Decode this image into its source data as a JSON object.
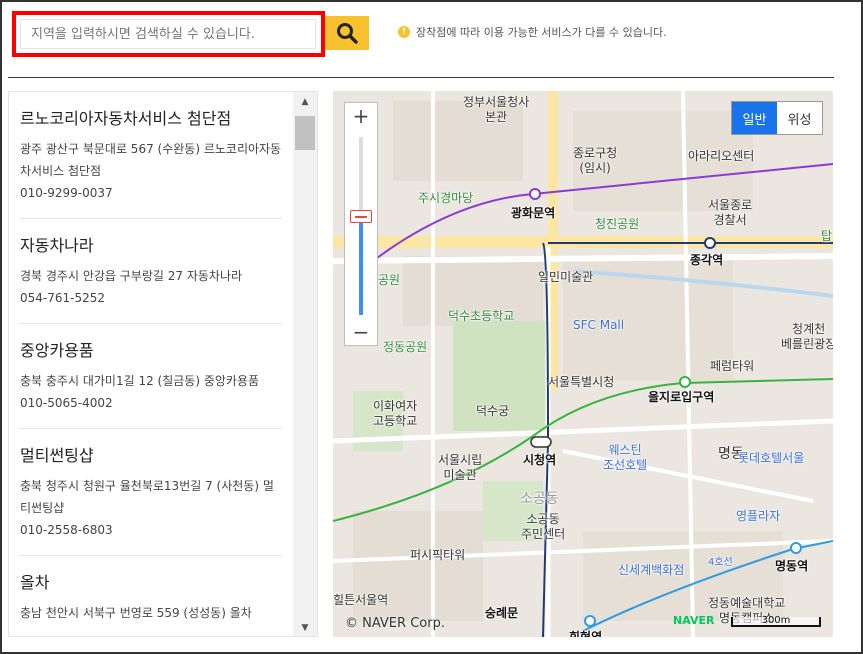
{
  "search": {
    "placeholder": "지역을 입력하시면 검색하실 수 있습니다."
  },
  "notice": {
    "text": "장착점에 따라 이용 가능한 서비스가 다를 수 있습니다."
  },
  "shops": [
    {
      "name": "르노코리아자동차서비스 첨단점",
      "address": "광주 광산구 북문대로 567 (수완동) 르노코리아자동차서비스 첨단점",
      "phone": "010-9299-0037"
    },
    {
      "name": "자동차나라",
      "address": "경북 경주시 안강읍 구부랑길 27 자동차나라",
      "phone": "054-761-5252"
    },
    {
      "name": "중앙카용품",
      "address": "충북 충주시 대가미1길 12 (칠금동) 중앙카용품",
      "phone": "010-5065-4002"
    },
    {
      "name": "멀티썬팅샵",
      "address": "충북 청주시 청원구 율천북로13번길 7 (사천동) 멀티썬팅샵",
      "phone": "010-2558-6803"
    },
    {
      "name": "올차",
      "address": "충남 천안시 서북구 번영로 559 (성성동) 올차",
      "phone": ""
    }
  ],
  "map": {
    "type_buttons": {
      "normal": "일반",
      "satellite": "위성"
    },
    "copyright": "© NAVER Corp.",
    "logo": "NAVER",
    "scale": "300m",
    "labels": {
      "gov": "정부서울청사\n본관",
      "jongno_office": "종로구청\n(임시)",
      "arario": "아라리오센터",
      "jusigyeong": "주시경마당",
      "gwanghwamun": "광화문역",
      "cheongjin": "청진공원",
      "seoul_jongno_police": "서울종로\n경찰서",
      "jonggak": "종각역",
      "ilmin": "일민미술관",
      "park": "공원",
      "deoksu_school": "덕수초등학교",
      "sfc": "SFC Mall",
      "cheonggye": "청계천\n베를린광장",
      "jeongdong": "정동공원",
      "plaza_tower": "페럼타워",
      "seoul_plaza": "서울특별시청",
      "euljiro1": "을지로입구역",
      "ewha": "이화여자\n고등학교",
      "deoksugung": "덕수궁",
      "seoul_museum": "서울시립\n미술관",
      "city_hall": "시청역",
      "westin": "웨스틴\n조선호텔",
      "myeongdong": "명동",
      "lotte": "롯데호텔서울",
      "sogong": "소공동\n주민센터",
      "sogong_big": "소공동",
      "young_plaza": "영플라자",
      "pc_tower": "퍼시픽타워",
      "shinsegae": "신세계백화점",
      "line4": "4호선",
      "myeongdong_st": "명동역",
      "namdaemun": "숭례문",
      "seoul_station_area": "힐튼서울역",
      "art_univ": "정동예술대학교\n명동캠퍼스",
      "hoehyeon": "회현역",
      "tab": "탑"
    }
  }
}
